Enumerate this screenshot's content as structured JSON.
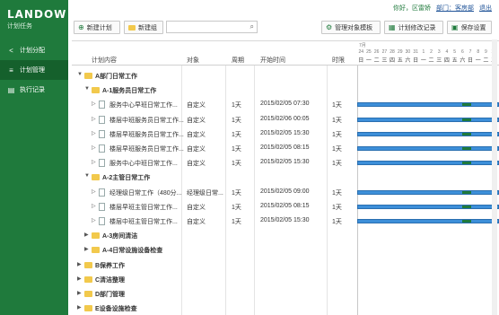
{
  "app": {
    "logo": "LANDOW",
    "subtitle": "计划任务"
  },
  "sidebar": {
    "items": [
      {
        "label": "计划分配",
        "icon": "share-icon"
      },
      {
        "label": "计划管理",
        "icon": "list-icon"
      },
      {
        "label": "执行记录",
        "icon": "record-icon"
      }
    ]
  },
  "topbar": {
    "greeting": "你好，区雷娇",
    "dept": "部门：客房部",
    "logout": "退出"
  },
  "toolbar": {
    "new_plan": "新建计划",
    "new_group": "新建组",
    "search_placeholder": "",
    "manage_templates": "管理对象模板",
    "plan_changes": "计划修改记录",
    "save_settings": "保存设置"
  },
  "table": {
    "headers": {
      "content": "计划内容",
      "target": "对象",
      "cycle": "周期",
      "start": "开始时间",
      "limit": "时限"
    },
    "gantt_top": "7月",
    "gantt_days": [
      "日",
      "一",
      "二",
      "三",
      "四",
      "五",
      "六",
      "日",
      "一",
      "二",
      "三",
      "四",
      "五",
      "六",
      "日",
      "一",
      "二",
      "三"
    ],
    "gantt_dates": [
      "24",
      "25",
      "26",
      "27",
      "28",
      "29",
      "30",
      "31",
      "1",
      "2",
      "3",
      "4",
      "5",
      "6",
      "7",
      "8",
      "9",
      "10"
    ],
    "rows": [
      {
        "type": "group",
        "level": 0,
        "label": "A部门日常工作"
      },
      {
        "type": "group",
        "level": 1,
        "label": "A-1服务员日常工作"
      },
      {
        "type": "item",
        "level": 2,
        "label": "服务中心早班日常工作...",
        "target": "自定义",
        "cycle": "1天",
        "start": "2015/02/05 07:30",
        "limit": "1天"
      },
      {
        "type": "item",
        "level": 2,
        "label": "楼层中班服务员日常工作...",
        "target": "自定义",
        "cycle": "1天",
        "start": "2015/02/06 00:05",
        "limit": "1天"
      },
      {
        "type": "item",
        "level": 2,
        "label": "楼层早班服务员日常工作...",
        "target": "自定义",
        "cycle": "1天",
        "start": "2015/02/05 15:30",
        "limit": "1天"
      },
      {
        "type": "item",
        "level": 2,
        "label": "楼层早班服务员日常工作...",
        "target": "自定义",
        "cycle": "1天",
        "start": "2015/02/05 08:15",
        "limit": "1天"
      },
      {
        "type": "item",
        "level": 2,
        "label": "服务中心中班日常工作...",
        "target": "自定义",
        "cycle": "1天",
        "start": "2015/02/05 15:30",
        "limit": "1天"
      },
      {
        "type": "group",
        "level": 1,
        "label": "A-2主管日常工作"
      },
      {
        "type": "item",
        "level": 2,
        "label": "经理级日常工作（480分...",
        "target": "经理级日常...",
        "cycle": "1天",
        "start": "2015/02/05 09:00",
        "limit": "1天"
      },
      {
        "type": "item",
        "level": 2,
        "label": "楼层早班主管日常工作...",
        "target": "自定义",
        "cycle": "1天",
        "start": "2015/02/05 08:15",
        "limit": "1天"
      },
      {
        "type": "item",
        "level": 2,
        "label": "楼层中班主管日常工作...",
        "target": "自定义",
        "cycle": "1天",
        "start": "2015/02/05 15:30",
        "limit": "1天"
      },
      {
        "type": "group",
        "level": 1,
        "label": "A-3房间清洁"
      },
      {
        "type": "group",
        "level": 1,
        "label": "A-4日常设施设备检查"
      },
      {
        "type": "group",
        "level": 0,
        "label": "B保养工作"
      },
      {
        "type": "group",
        "level": 0,
        "label": "C清洁整理"
      },
      {
        "type": "group",
        "level": 0,
        "label": "D部门管理"
      },
      {
        "type": "group",
        "level": 0,
        "label": "E设备设施检查"
      }
    ]
  },
  "colors": {
    "sidebar": "#1f7a3c",
    "bar": "#3d8fd9",
    "folder": "#f2c94c"
  }
}
